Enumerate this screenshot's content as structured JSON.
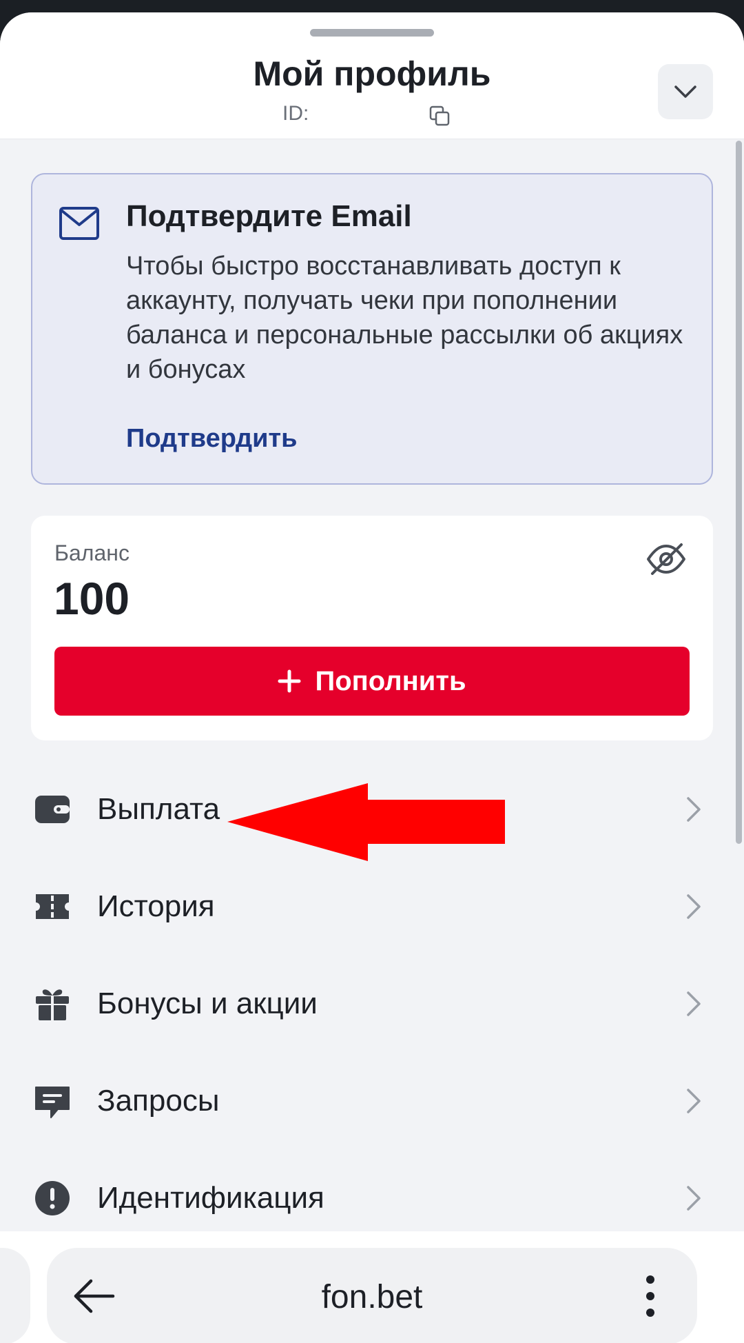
{
  "header": {
    "title": "Мой профиль",
    "id_label": "ID:"
  },
  "email_card": {
    "title": "Подтвердите Email",
    "text": "Чтобы быстро восстанавливать доступ к аккаунту, получать чеки при пополнении баланса и персональные рассылки об акциях и бонусах",
    "link": "Подтвердить"
  },
  "balance": {
    "label": "Баланс",
    "value": "100",
    "topup_label": "Пополнить"
  },
  "menu": {
    "items": [
      {
        "label": "Выплата",
        "icon": "wallet-icon"
      },
      {
        "label": "История",
        "icon": "ticket-icon"
      },
      {
        "label": "Бонусы и акции",
        "icon": "gift-icon"
      },
      {
        "label": "Запросы",
        "icon": "chat-icon"
      },
      {
        "label": "Идентификация",
        "icon": "alert-icon"
      }
    ]
  },
  "browser": {
    "url": "fon.bet"
  },
  "colors": {
    "accent_red": "#e5002b",
    "link_blue": "#1f3b8a",
    "annotation_arrow": "#ff0000"
  }
}
